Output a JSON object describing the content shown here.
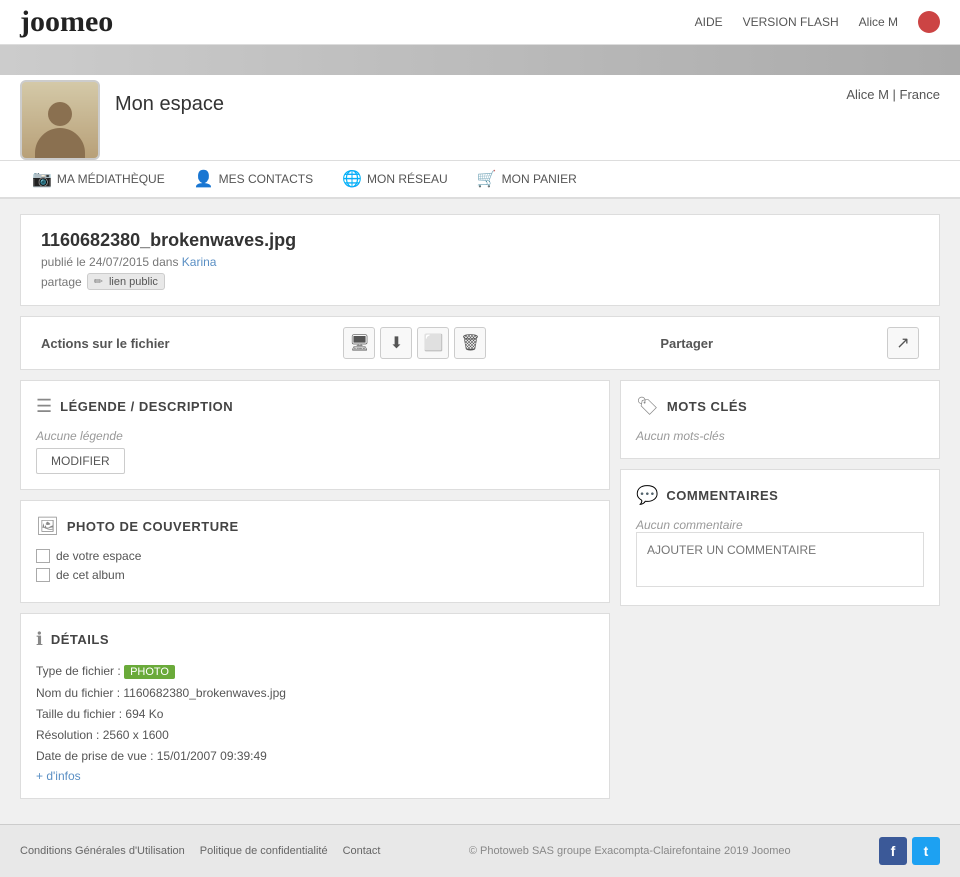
{
  "header": {
    "logo": "joomeo",
    "links": [
      "AIDE",
      "VERSION FLASH"
    ],
    "user": "Alice M",
    "avatar_color": "#c44"
  },
  "profile": {
    "title": "Mon espace",
    "user_info": "Alice M | France"
  },
  "nav": {
    "items": [
      {
        "label": "MA MÉDIATHÈQUE",
        "icon": "📷"
      },
      {
        "label": "MES CONTACTS",
        "icon": "👤"
      },
      {
        "label": "MON RÉSEAU",
        "icon": "🌐"
      },
      {
        "label": "MON PANIER",
        "icon": "🛒"
      }
    ]
  },
  "file": {
    "title": "1160682380_brokenwaves.jpg",
    "published": "publié le 24/07/2015 dans",
    "album_link": "Karina",
    "partage_label": "partage",
    "lien_public": "lien public"
  },
  "actions": {
    "label": "Actions sur le fichier",
    "partager_label": "Partager",
    "buttons": [
      "🖥",
      "⬇",
      "⬜",
      "🗑"
    ]
  },
  "legende": {
    "title": "LÉGENDE / DESCRIPTION",
    "no_legende": "Aucune légende",
    "modifier_btn": "MODIFIER"
  },
  "photo_couverture": {
    "title": "PHOTO DE COUVERTURE",
    "option1": "de votre espace",
    "option2": "de cet album"
  },
  "details": {
    "title": "DÉTAILS",
    "type_label": "Type de fichier :",
    "type_value": "PHOTO",
    "nom_label": "Nom du fichier :",
    "nom_value": "1160682380_brokenwaves.jpg",
    "taille_label": "Taille du fichier :",
    "taille_value": "694 Ko",
    "resolution_label": "Résolution :",
    "resolution_value": "2560 x 1600",
    "date_label": "Date de prise de vue :",
    "date_value": "15/01/2007 09:39:49",
    "more_link": "+ d'infos"
  },
  "mots_cles": {
    "title": "MOTS CLÉS",
    "no_mots_cles": "Aucun mots-clés"
  },
  "commentaires": {
    "title": "COMMENTAIRES",
    "no_commentaire": "Aucun commentaire",
    "placeholder": "AJOUTER UN COMMENTAIRE"
  },
  "footer": {
    "links": [
      "Conditions Générales d'Utilisation",
      "Politique de confidentialité",
      "Contact"
    ],
    "copyright": "© Photoweb SAS groupe Exacompta-Clairefontaine 2019 Joomeo",
    "facebook_label": "f",
    "twitter_label": "t"
  }
}
